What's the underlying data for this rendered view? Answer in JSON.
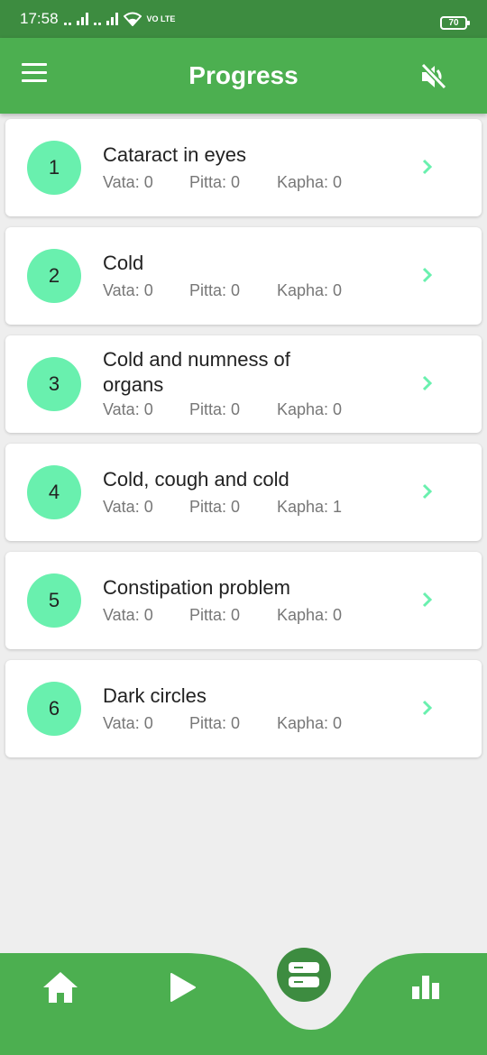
{
  "status_bar": {
    "time": "17:58",
    "network": "VO LTE",
    "battery": "70"
  },
  "app_bar": {
    "title": "Progress",
    "menu_icon": "menu-icon",
    "mute_icon": "volume-off-icon"
  },
  "items": [
    {
      "number": "1",
      "title": "Cataract in eyes",
      "vata": "Vata: 0",
      "pitta": "Pitta: 0",
      "kapha": "Kapha: 0"
    },
    {
      "number": "2",
      "title": "Cold",
      "vata": "Vata: 0",
      "pitta": "Pitta: 0",
      "kapha": "Kapha: 0"
    },
    {
      "number": "3",
      "title": "Cold and numness of organs",
      "vata": "Vata: 0",
      "pitta": "Pitta: 0",
      "kapha": "Kapha: 0"
    },
    {
      "number": "4",
      "title": "Cold, cough and cold",
      "vata": "Vata: 0",
      "pitta": "Pitta: 0",
      "kapha": "Kapha: 1"
    },
    {
      "number": "5",
      "title": "Constipation problem",
      "vata": "Vata: 0",
      "pitta": "Pitta: 0",
      "kapha": "Kapha: 0"
    },
    {
      "number": "6",
      "title": "Dark circles",
      "vata": "Vata: 0",
      "pitta": "Pitta: 0",
      "kapha": "Kapha: 0"
    }
  ],
  "bottom_nav": {
    "icons": [
      "home-icon",
      "play-icon",
      "list-icon",
      "bar-chart-icon"
    ],
    "active": "list-icon"
  },
  "colors": {
    "primary": "#4caf50",
    "status_bar": "#3d8c40",
    "accent": "#69f0ae",
    "background": "#eeeeee"
  }
}
